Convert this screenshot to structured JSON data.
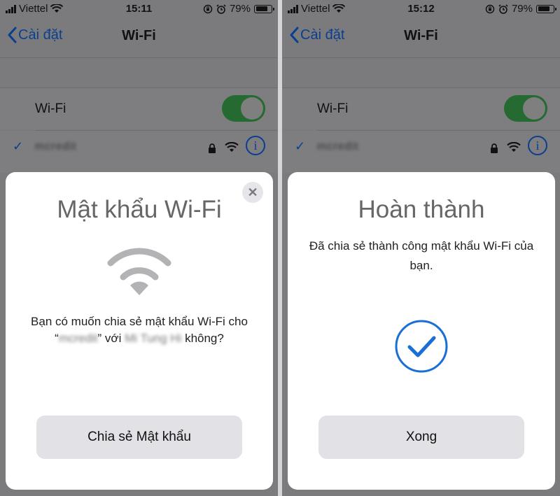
{
  "status_left": {
    "carrier": "Viettel",
    "time": "15:11",
    "battery": "79%"
  },
  "status_right": {
    "carrier": "Viettel",
    "time": "15:12",
    "battery": "79%"
  },
  "nav": {
    "back_label": "Cài đặt",
    "title": "Wi-Fi"
  },
  "settings": {
    "wifi_label": "Wi-Fi",
    "network_name": "mcredit"
  },
  "share_sheet": {
    "title": "Mật khẩu Wi-Fi",
    "message_part1": "Bạn có muốn chia sẻ mật khẩu Wi-Fi cho “",
    "network_blurred": "mcredit",
    "message_part2": "” với ",
    "contact_blurred": "Mi Tung Hi",
    "message_part3": " không?",
    "button_label": "Chia sẻ Mật khẩu"
  },
  "done_sheet": {
    "title": "Hoàn thành",
    "message": "Đã chia sẻ thành công mật khẩu Wi-Fi của bạn.",
    "button_label": "Xong"
  },
  "colors": {
    "accent": "#0a3f8f",
    "toggle_on": "#256a30",
    "check_blue": "#1a6fd6"
  },
  "icons": [
    "signal-bars-icon",
    "wifi-icon",
    "lock-rotation-icon",
    "alarm-icon",
    "battery-icon",
    "chevron-left-icon",
    "checkmark-icon",
    "lock-icon",
    "info-icon",
    "close-icon"
  ]
}
